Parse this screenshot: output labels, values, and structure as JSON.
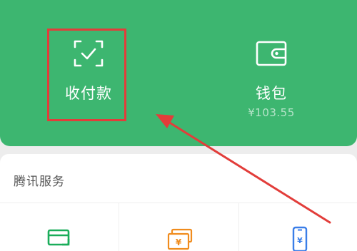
{
  "pay_card": {
    "receive_label": "收付款",
    "wallet_label": "钱包",
    "wallet_balance": "¥103.55"
  },
  "services": {
    "title": "腾讯服务",
    "items": [
      {
        "icon": "credit-card-icon"
      },
      {
        "icon": "money-stack-icon"
      },
      {
        "icon": "mobile-recharge-icon"
      }
    ]
  },
  "colors": {
    "brand_green": "#3db670",
    "annotation_red": "#e23d3a",
    "card_icon_green": "#1aad5a",
    "money_icon_orange": "#f08c1d",
    "phone_icon_blue": "#3a7ee8"
  },
  "annotations": {
    "highlight_box": "receive-payment",
    "arrow": "points-to-receive-payment"
  }
}
